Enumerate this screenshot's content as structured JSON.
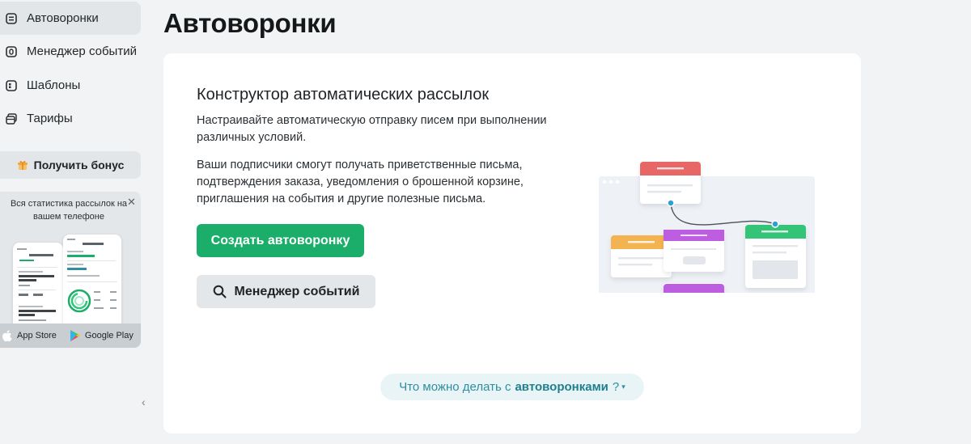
{
  "sidebar": {
    "items": [
      {
        "label": "Автоворонки",
        "icon": "funnel-icon",
        "active": true
      },
      {
        "label": "Менеджер событий",
        "icon": "event-icon",
        "active": false
      },
      {
        "label": "Шаблоны",
        "icon": "template-icon",
        "active": false
      },
      {
        "label": "Тарифы",
        "icon": "card-icon",
        "active": false
      }
    ],
    "bonus_label": "Получить бонус",
    "promo": {
      "text": "Вся статистика рассылок на вашем телефоне",
      "close": "✕",
      "app_store": "App Store",
      "google_play": "Google Play"
    },
    "collapse": "‹"
  },
  "main": {
    "title": "Автоворонки",
    "card": {
      "heading": "Конструктор автоматических рассылок",
      "paragraph1": "Настраивайте автоматическую отправку писем при выполнении различных условий.",
      "paragraph2": "Ваши подписчики смогут получать приветственные письма, подтверждения заказа, уведомления о брошенной корзине, приглашения на события и другие полезные письма.",
      "create_button": "Создать автоворонку",
      "events_button": "Менеджер событий",
      "help_prefix": "Что можно делать с",
      "help_bold": "автоворонками",
      "help_q": "?",
      "help_caret": "▾"
    }
  },
  "colors": {
    "primary": "#1bae6a",
    "sidebar_active": "#e2e6e8",
    "accent_red": "#e76666",
    "accent_orange": "#f4b351",
    "accent_green": "#34c477",
    "accent_purple": "#bd5ee0",
    "link": "#2e8fa0"
  }
}
